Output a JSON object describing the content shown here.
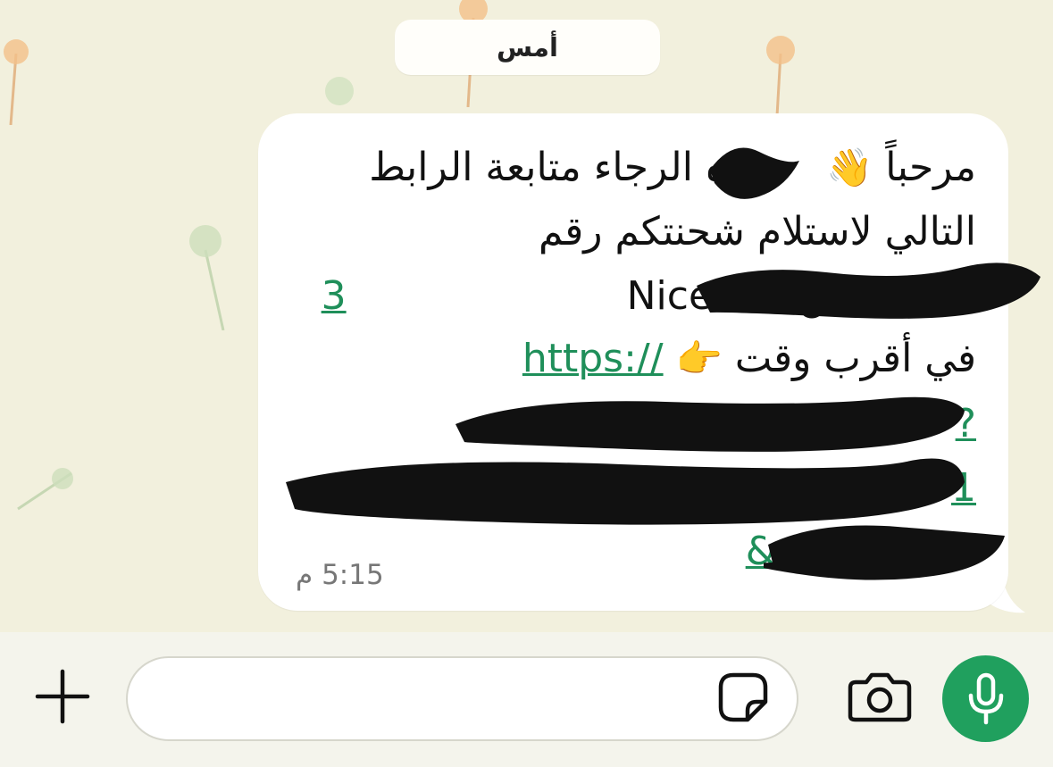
{
  "chat": {
    "date_chip": "أمس",
    "message": {
      "line1": {
        "start": "مرحباً",
        "wave_emoji": "👋",
        "after_redaction": "ه الرجاء متابعة الرابط"
      },
      "line2": "التالي لاستلام شحنتكم رقم",
      "line3": {
        "text_before": "القادمة من Niceone",
        "tracking_visible": "3"
      },
      "line4": {
        "text": "في أقرب وقت",
        "point_emoji": "👉",
        "link_start": "https://"
      },
      "line5_visible": "?",
      "line6_visible": "1",
      "line7_visible": "&",
      "time": "5:15 م"
    }
  },
  "composer": {
    "plus_icon": "plus-icon",
    "sticker_icon": "sticker-icon",
    "camera_icon": "camera-icon",
    "mic_icon": "microphone-icon",
    "input_value": "",
    "colors": {
      "send_green": "#20a05e",
      "link_green": "#1f8f5a",
      "wallpaper": "#f2f0dd"
    }
  }
}
